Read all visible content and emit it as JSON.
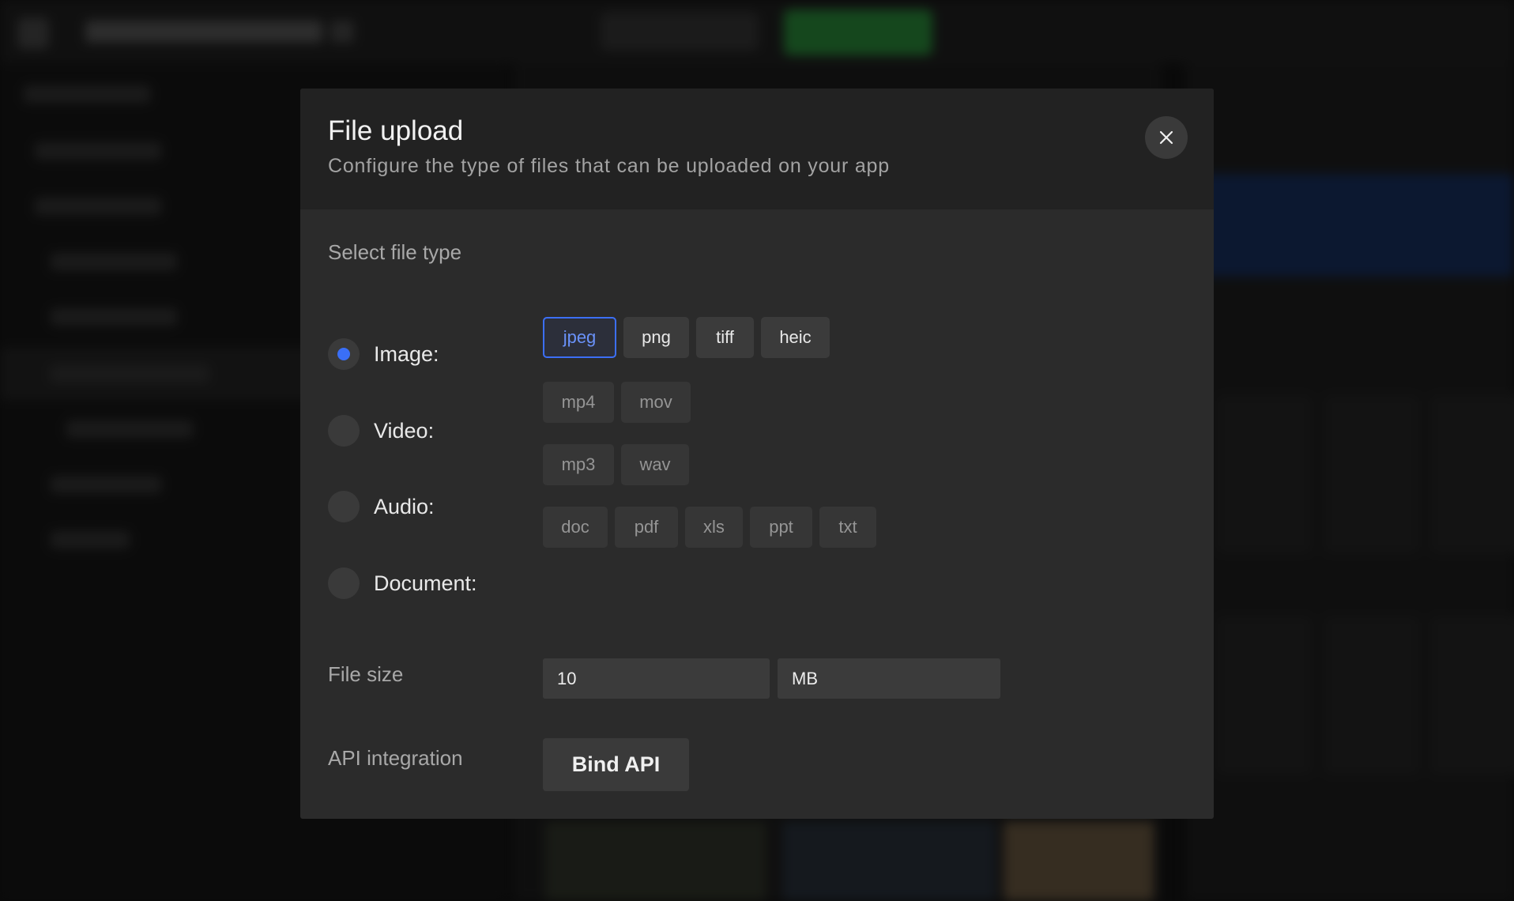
{
  "modal": {
    "title": "File upload",
    "subtitle": "Configure the type of files that can be uploaded on your app",
    "close_icon": "close-icon",
    "select_file_type_label": "Select file type",
    "file_types": [
      {
        "label": "Image:",
        "checked": true,
        "formats": [
          "jpeg",
          "png",
          "tiff",
          "heic"
        ],
        "selected_format": "jpeg"
      },
      {
        "label": "Video:",
        "checked": false,
        "formats": [
          "mp4",
          "mov"
        ]
      },
      {
        "label": "Audio:",
        "checked": false,
        "formats": [
          "mp3",
          "wav"
        ]
      },
      {
        "label": "Document:",
        "checked": false,
        "formats": [
          "doc",
          "pdf",
          "xls",
          "ppt",
          "txt"
        ]
      }
    ],
    "file_size_label": "File size",
    "file_size_value": "10",
    "file_size_unit": "MB",
    "api_integration_label": "API integration",
    "bind_api_label": "Bind API"
  },
  "colors": {
    "accent": "#3a6ff7",
    "modal_bg": "#2b2b2b",
    "modal_header_bg": "#222222",
    "overlay_bg": "#0a0a0a"
  }
}
